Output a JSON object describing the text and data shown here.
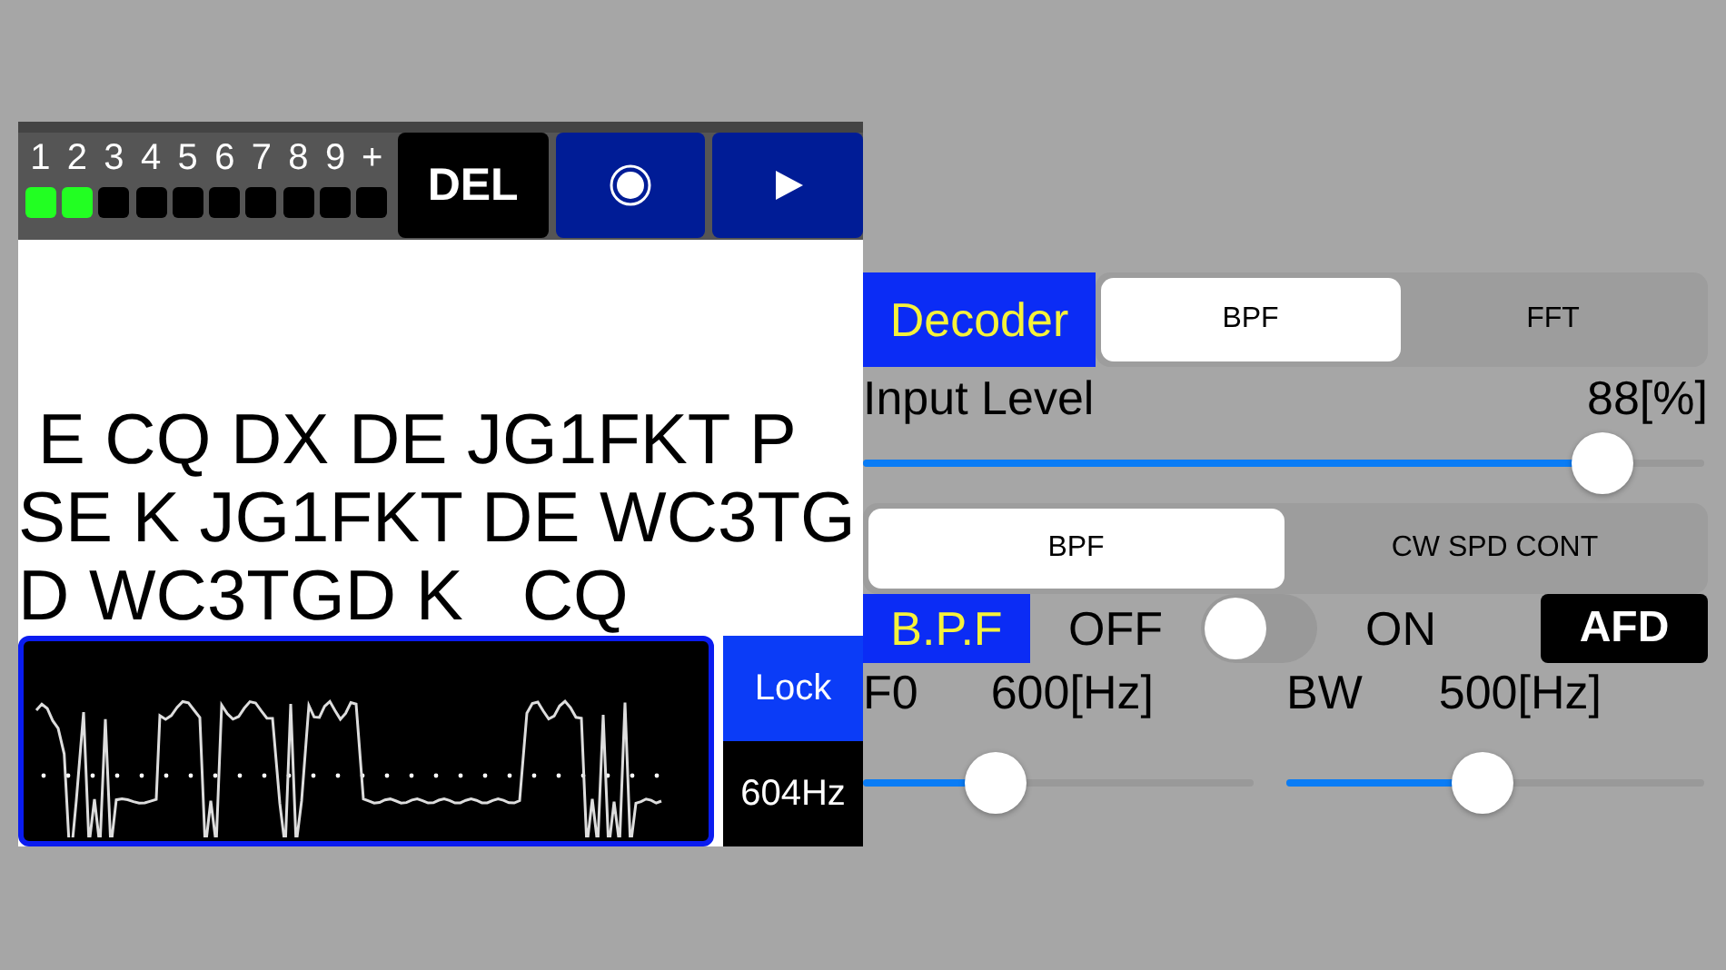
{
  "channels": [
    {
      "label": "1",
      "lit": true
    },
    {
      "label": "2",
      "lit": true
    },
    {
      "label": "3",
      "lit": false
    },
    {
      "label": "4",
      "lit": false
    },
    {
      "label": "5",
      "lit": false
    },
    {
      "label": "6",
      "lit": false
    },
    {
      "label": "7",
      "lit": false
    },
    {
      "label": "8",
      "lit": false
    },
    {
      "label": "9",
      "lit": false
    },
    {
      "label": "+",
      "lit": false
    }
  ],
  "buttons": {
    "delete": "DEL"
  },
  "decoded_text": [
    " E CQ DX DE JG1FKT P",
    "SE K JG1FKT DE WC3TG",
    "D WC3TGD K   CQ"
  ],
  "scope": {
    "lock": "Lock",
    "frequency": "604Hz"
  },
  "decoder": {
    "label": "Decoder",
    "tabs": [
      {
        "label": "BPF",
        "selected": true
      },
      {
        "label": "FFT",
        "selected": false
      }
    ]
  },
  "input_level": {
    "label": "Input Level",
    "reading": "88[%]",
    "level": 0.88
  },
  "mode_tabs": [
    {
      "label": "BPF",
      "selected": true
    },
    {
      "label": "CW SPD CONT",
      "selected": false
    }
  ],
  "bpf": {
    "label": "B.P.F",
    "off": "OFF",
    "on_label": "ON",
    "on": false,
    "afd": "AFD"
  },
  "f0": {
    "label": "F0",
    "reading": "600[Hz]",
    "level": 0.34
  },
  "bw": {
    "label": "BW",
    "reading": "500[Hz]",
    "level": 0.47
  }
}
